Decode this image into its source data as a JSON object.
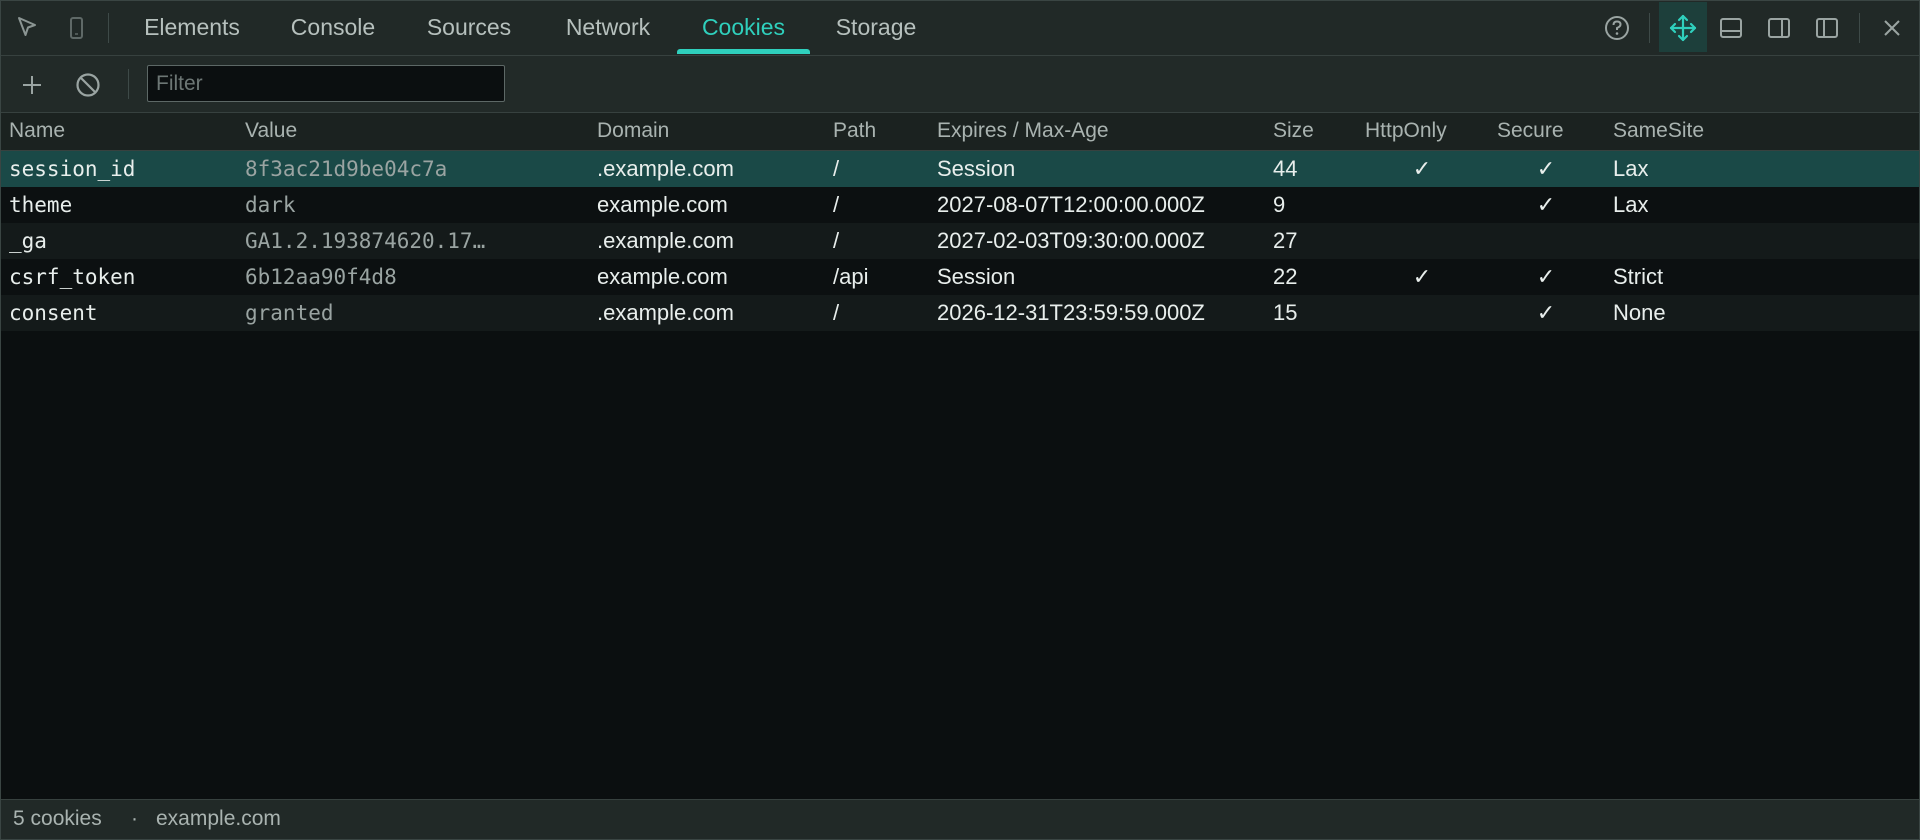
{
  "tabs": [
    {
      "label": "Elements"
    },
    {
      "label": "Console"
    },
    {
      "label": "Sources"
    },
    {
      "label": "Network"
    },
    {
      "label": "Cookies",
      "active": true
    },
    {
      "label": "Storage"
    }
  ],
  "toolbar": {
    "filter_placeholder": "Filter",
    "filter_value": ""
  },
  "columns": {
    "name": "Name",
    "value": "Value",
    "domain": "Domain",
    "path": "Path",
    "expires": "Expires / Max-Age",
    "size": "Size",
    "httponly": "HttpOnly",
    "secure": "Secure",
    "samesite": "SameSite"
  },
  "cookies": [
    {
      "name": "session_id",
      "value": "8f3ac21d9be04c7a",
      "domain": ".example.com",
      "path": "/",
      "expires": "Session",
      "size": "44",
      "httponly": "✓",
      "secure": "✓",
      "samesite": "Lax"
    },
    {
      "name": "theme",
      "value": "dark",
      "domain": "example.com",
      "path": "/",
      "expires": "2027-08-07T12:00:00.000Z",
      "size": "9",
      "httponly": "",
      "secure": "✓",
      "samesite": "Lax"
    },
    {
      "name": "_ga",
      "value": "GA1.2.193874620.17…",
      "domain": ".example.com",
      "path": "/",
      "expires": "2027-02-03T09:30:00.000Z",
      "size": "27",
      "httponly": "",
      "secure": "",
      "samesite": ""
    },
    {
      "name": "csrf_token",
      "value": "6b12aa90f4d8",
      "domain": "example.com",
      "path": "/api",
      "expires": "Session",
      "size": "22",
      "httponly": "✓",
      "secure": "✓",
      "samesite": "Strict"
    },
    {
      "name": "consent",
      "value": "granted",
      "domain": ".example.com",
      "path": "/",
      "expires": "2026-12-31T23:59:59.000Z",
      "size": "15",
      "httponly": "",
      "secure": "✓",
      "samesite": "None"
    }
  ],
  "status": {
    "count": "5 cookies",
    "separator": "·",
    "domain": "example.com"
  },
  "icons": {
    "inspect": "inspect-cursor-icon",
    "device": "device-toolbar-icon",
    "help": "help-icon",
    "move": "move-icon",
    "dock_bottom": "dock-bottom-icon",
    "dock_right": "dock-right-icon",
    "dock_left": "dock-left-icon",
    "close": "close-icon",
    "add": "add-icon",
    "clear": "clear-icon"
  },
  "colors": {
    "accent": "#2fd0bd",
    "selected_row": "#1a4947",
    "background": "#0b0f10"
  }
}
